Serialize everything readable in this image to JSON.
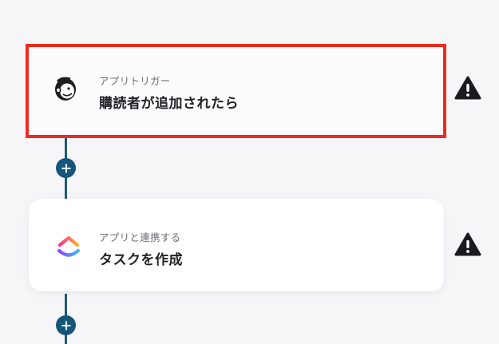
{
  "flow": {
    "steps": [
      {
        "subtitle": "アプリトリガー",
        "title": "購読者が追加されたら",
        "app_icon": "mailchimp-icon",
        "status_icon": "warning-icon",
        "selected": true
      },
      {
        "subtitle": "アプリと連携する",
        "title": "タスクを作成",
        "app_icon": "clickup-icon",
        "status_icon": "warning-icon",
        "selected": false
      }
    ],
    "add_step_icon": "plus-icon"
  },
  "colors": {
    "selection_border": "#ee2b1f",
    "connector": "#1f5a78",
    "add_button": "#14567a",
    "warning": "#1b1b1f",
    "background": "#f6f5f8"
  }
}
